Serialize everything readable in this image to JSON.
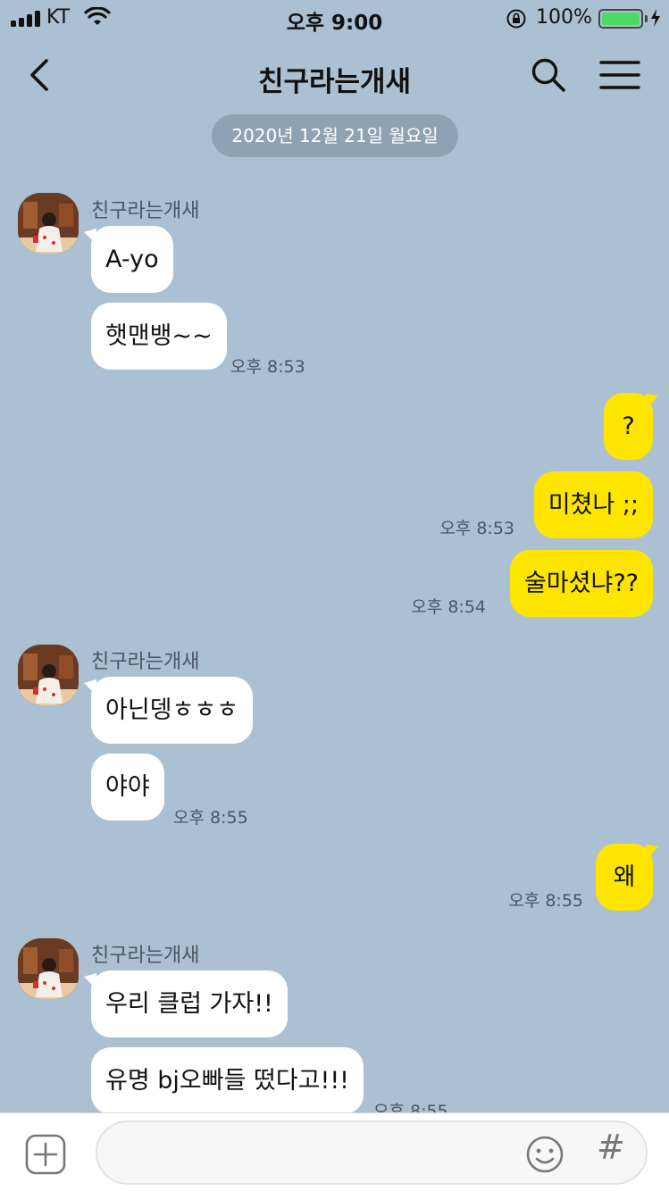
{
  "status_bar": {
    "carrier": "KT",
    "time": "오후 9:00",
    "battery_text": "100%",
    "battery_level": 1.0,
    "battery_color": "#4cd964"
  },
  "nav": {
    "title": "친구라는개새",
    "back_icon": "chevron-left-icon",
    "search_icon": "search-icon",
    "menu_icon": "hamburger-menu-icon"
  },
  "date_divider": "2020년 12월 21일 월요일",
  "groups": [
    {
      "sender": "친구라는개새",
      "messages": [
        "A-yo",
        "햇맨뱅~~"
      ],
      "time": "오후 8:53"
    },
    {
      "me": true,
      "messages": [
        "?",
        "미쳤나 ;;"
      ],
      "time": "오후 8:53"
    },
    {
      "me": true,
      "messages": [
        "술마셨냐??"
      ],
      "time": "오후 8:54"
    },
    {
      "sender": "친구라는개새",
      "messages": [
        "아닌뎅ㅎㅎㅎ",
        "야야"
      ],
      "time": "오후 8:55"
    },
    {
      "me": true,
      "messages": [
        "왜"
      ],
      "time": "오후 8:55"
    },
    {
      "sender": "친구라는개새",
      "messages": [
        "우리 클럽 가자!!",
        "유명 bj오빠들 떴다고!!!"
      ],
      "time": "오후 8:55"
    }
  ],
  "input": {
    "placeholder": "",
    "plus_icon": "plus-square-icon",
    "emoji_icon": "emoji-icon",
    "hash_label": "#"
  },
  "colors": {
    "chat_background": "#abc0d3",
    "my_bubble": "#fee500",
    "their_bubble": "#ffffff",
    "date_pill": "#8fa2b3"
  }
}
